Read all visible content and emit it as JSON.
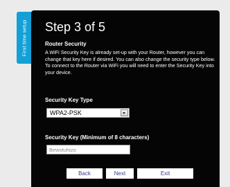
{
  "side_tab": {
    "label": "First time setup"
  },
  "header": {
    "title": "Step 3 of 5"
  },
  "section": {
    "title": "Router Security",
    "description": "A WiFi Security Key is already set-up with your Router, however you can change that key here if desired. You can also change the security type below. To connect to the Router via WiFi you will need to enter the Security Key into your device."
  },
  "security_key_type": {
    "label": "Security Key Type",
    "selected": "WPA2-PSK"
  },
  "security_key": {
    "label": "Security Key (Minimum of 8 characters)",
    "value": "Bewotuhizo"
  },
  "buttons": {
    "back": "Back",
    "next": "Next",
    "exit": "Exit"
  },
  "colors": {
    "panel_bg": "#050505",
    "tab_accent": "#12a0d7",
    "page_bg": "#ebebeb"
  }
}
